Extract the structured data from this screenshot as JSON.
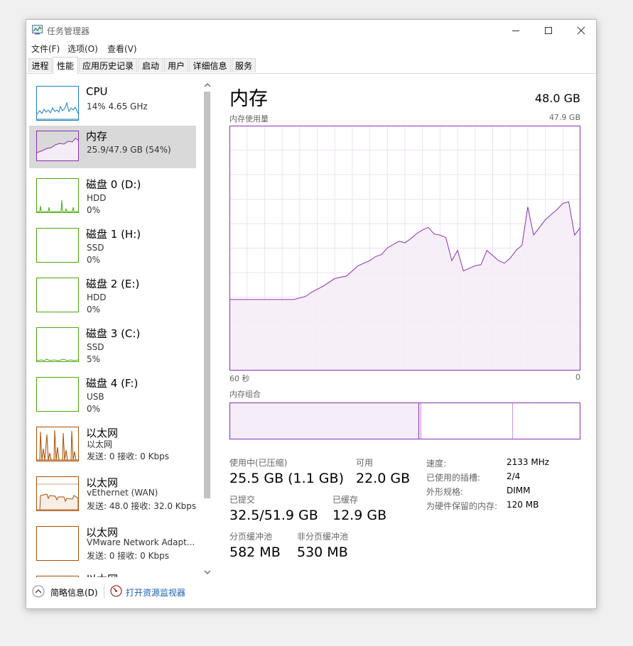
{
  "window": {
    "title": "任务管理器"
  },
  "menu": [
    "文件(F)",
    "选项(O)",
    "查看(V)"
  ],
  "tabs": [
    "进程",
    "性能",
    "应用历史记录",
    "启动",
    "用户",
    "详细信息",
    "服务"
  ],
  "active_tab": "性能",
  "sidebar": {
    "items": [
      {
        "title": "CPU",
        "line1": "14%  4.65 GHz",
        "line2": "",
        "color": "#1b7fba"
      },
      {
        "title": "内存",
        "line1": "25.9/47.9 GB (54%)",
        "line2": "",
        "color": "#8b2fb0",
        "selected": true
      },
      {
        "title": "磁盘 0 (D:)",
        "line1": "HDD",
        "line2": "0%",
        "color": "#4da60c"
      },
      {
        "title": "磁盘 1 (H:)",
        "line1": "SSD",
        "line2": "0%",
        "color": "#4da60c"
      },
      {
        "title": "磁盘 2 (E:)",
        "line1": "HDD",
        "line2": "0%",
        "color": "#4da60c"
      },
      {
        "title": "磁盘 3 (C:)",
        "line1": "SSD",
        "line2": "5%",
        "color": "#4da60c"
      },
      {
        "title": "磁盘 4 (F:)",
        "line1": "USB",
        "line2": "0%",
        "color": "#4da60c"
      },
      {
        "title": "以太网",
        "line1": "以太网",
        "line2": "发送: 0 接收: 0 Kbps",
        "color": "#a74f01"
      },
      {
        "title": "以太网",
        "line1": "vEthernet (WAN)",
        "line2": "发送: 48.0  接收: 32.0 Kbps",
        "color": "#a74f01"
      },
      {
        "title": "以太网",
        "line1": "VMware Network Adapt...",
        "line2": "发送: 0 接收: 0 Kbps",
        "color": "#a74f01"
      },
      {
        "title": "以太网",
        "line1": "",
        "line2": "",
        "color": "#a74f01"
      }
    ]
  },
  "footer": {
    "summary": "简略信息(D)",
    "monitor": "打开资源监视器"
  },
  "main": {
    "title": "内存",
    "total": "48.0 GB",
    "graph_label": "内存使用量",
    "graph_max": "47.9 GB",
    "graph_left": "60 秒",
    "graph_right": "0",
    "comp_label": "内存组合",
    "in_use_label": "使用中(已压缩)",
    "in_use_value": "25.5 GB (1.1 GB)",
    "available_label": "可用",
    "available_value": "22.0 GB",
    "committed_label": "已提交",
    "committed_value": "32.5/51.9 GB",
    "cached_label": "已缓存",
    "cached_value": "12.9 GB",
    "paged_label": "分页缓冲池",
    "paged_value": "582 MB",
    "nonpaged_label": "非分页缓冲池",
    "nonpaged_value": "530 MB",
    "speed_label": "速度:",
    "speed_value": "2133 MHz",
    "slots_label": "已使用的插槽:",
    "slots_value": "2/4",
    "form_label": "外形规格:",
    "form_value": "DIMM",
    "reserved_label": "为硬件保留的内存:",
    "reserved_value": "120 MB"
  },
  "chart_data": {
    "type": "area",
    "title": "内存使用量",
    "unit": "GB",
    "ylim": [
      0,
      47.9
    ],
    "xlim": [
      60,
      0
    ],
    "x": [
      60,
      57,
      54,
      51,
      49,
      47,
      46,
      44,
      42,
      40,
      39,
      38,
      36,
      35,
      34,
      33,
      31,
      30,
      29,
      28,
      27,
      26,
      25,
      24,
      23,
      22,
      21,
      20,
      19,
      18,
      17,
      16,
      14,
      13,
      12,
      11,
      10,
      9,
      8,
      7,
      6,
      5,
      4,
      3,
      2,
      1,
      0
    ],
    "values": [
      13.9,
      13.9,
      13.9,
      13.9,
      13.9,
      14.5,
      15.3,
      16.5,
      18.0,
      18.5,
      19.5,
      20.5,
      21.5,
      22.3,
      22.7,
      24.0,
      25.3,
      25.0,
      25.8,
      26.8,
      27.5,
      28.0,
      26.7,
      26.5,
      26.0,
      21.5,
      23.5,
      19.5,
      20.0,
      20.5,
      20.7,
      23.5,
      21.5,
      21.0,
      22.0,
      23.5,
      24.5,
      32.0,
      26.5,
      28.0,
      29.5,
      30.5,
      31.5,
      32.7,
      33.0,
      26.5,
      28.0
    ]
  }
}
